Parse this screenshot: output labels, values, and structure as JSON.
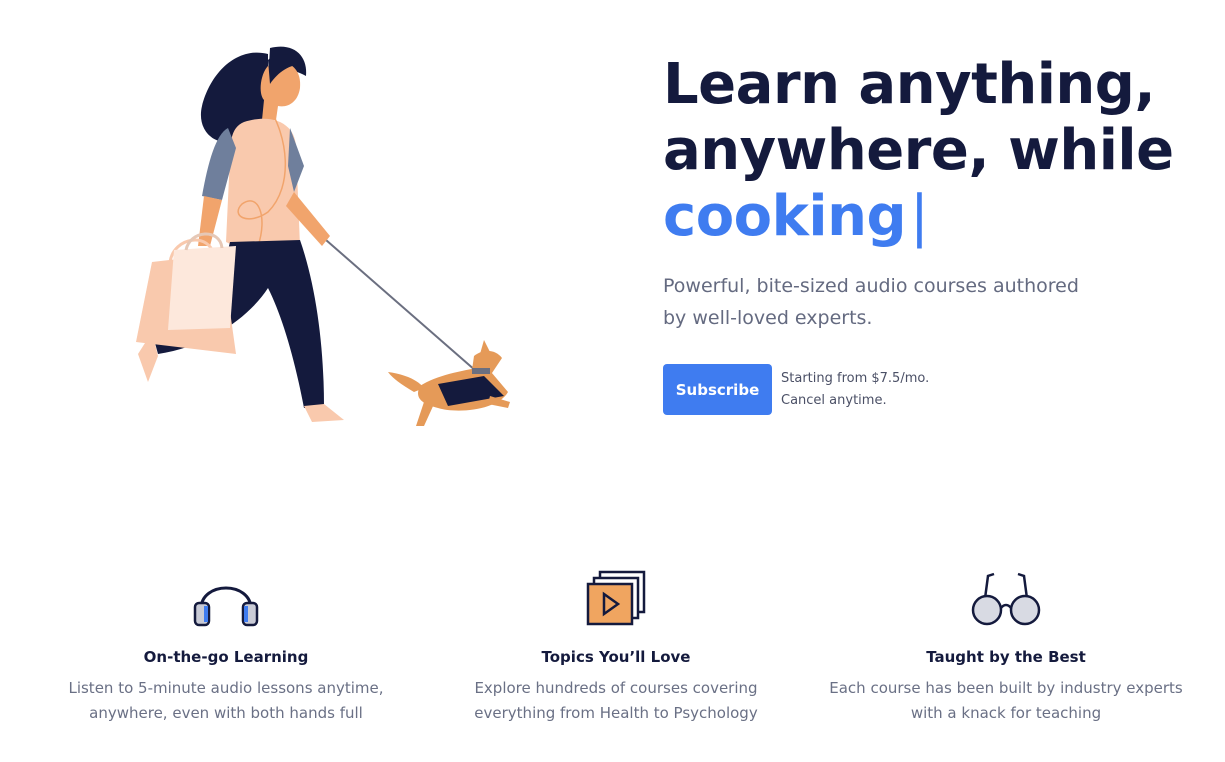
{
  "hero": {
    "headline_line1": "Learn anything,",
    "headline_line2": "anywhere, while",
    "headline_typed": "cooking",
    "cursor": "|",
    "subtitle_line1": "Powerful, bite-sized audio courses authored",
    "subtitle_line2": "by well-loved experts.",
    "subscribe_label": "Subscribe",
    "pricing_line1": "Starting from $7.5/mo.",
    "pricing_line2": "Cancel anytime."
  },
  "features": [
    {
      "icon": "headphones-icon",
      "title": "On-the-go Learning",
      "text_line1": "Listen to 5-minute audio lessons anytime,",
      "text_line2": "anywhere, even with both hands full"
    },
    {
      "icon": "video-stack-icon",
      "title": "Topics You’ll Love",
      "text_line1": "Explore hundreds of courses covering",
      "text_line2": "everything from Health to Psychology"
    },
    {
      "icon": "glasses-icon",
      "title": "Taught by the Best",
      "text_line1": "Each course has been built by industry experts",
      "text_line2": "with a knack for teaching"
    }
  ],
  "colors": {
    "accent": "#3f7cf0",
    "heading": "#141a3d",
    "body_text": "#646a80"
  }
}
